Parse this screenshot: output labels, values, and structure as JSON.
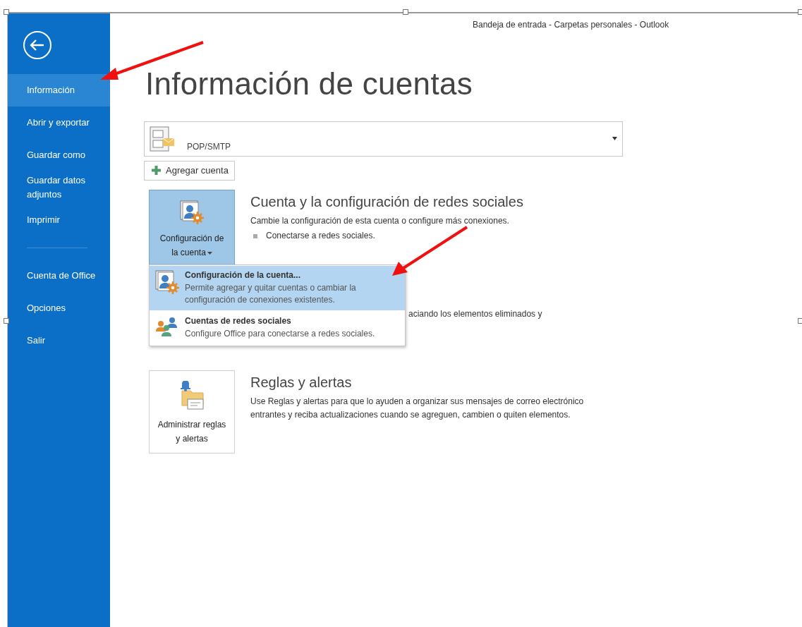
{
  "window": {
    "title": "Bandeja de entrada - Carpetas personales - Outlook"
  },
  "sidebar": {
    "groups": [
      {
        "items": [
          {
            "label": "Información",
            "selected": true
          },
          {
            "label": "Abrir y exportar",
            "selected": false
          },
          {
            "label": "Guardar como",
            "selected": false
          },
          {
            "label": "Guardar datos adjuntos",
            "selected": false
          },
          {
            "label": "Imprimir",
            "selected": false
          }
        ]
      },
      {
        "items": [
          {
            "label": "Cuenta de Office",
            "selected": false
          },
          {
            "label": "Opciones",
            "selected": false
          },
          {
            "label": "Salir",
            "selected": false
          }
        ]
      }
    ]
  },
  "main": {
    "heading": "Información de cuentas",
    "account": {
      "type": "POP/SMTP"
    },
    "add_account_button": {
      "label": "Agregar cuenta"
    },
    "sections": [
      {
        "kind": "settings",
        "button": {
          "label": "Configuración de la cuenta",
          "expanded": true
        },
        "title": "Cuenta y la configuración de redes sociales",
        "description": "Cambie la configuración de esta cuenta o configure más conexiones.",
        "bullets": [
          "Conectarse a redes sociales."
        ],
        "menu": {
          "items": [
            {
              "kind": "settings",
              "title": "Configuración de la cuenta...",
              "description": "Permite agregar y quitar cuentas o cambiar la configuración de conexiones existentes.",
              "selected": true
            },
            {
              "kind": "social",
              "title": "Cuentas de redes sociales",
              "description": "Configure Office para conectarse a redes sociales.",
              "selected": false
            }
          ]
        }
      },
      {
        "kind": "covered",
        "description": "aciando los elementos eliminados y"
      },
      {
        "kind": "rules",
        "button": {
          "label": "Administrar reglas y alertas",
          "expanded": false
        },
        "title": "Reglas y alertas",
        "description": "Use Reglas y alertas para que lo ayuden a organizar sus mensajes de correo electrónico entrantes y reciba actualizaciones cuando se agreguen, cambien o quiten elementos."
      }
    ]
  }
}
